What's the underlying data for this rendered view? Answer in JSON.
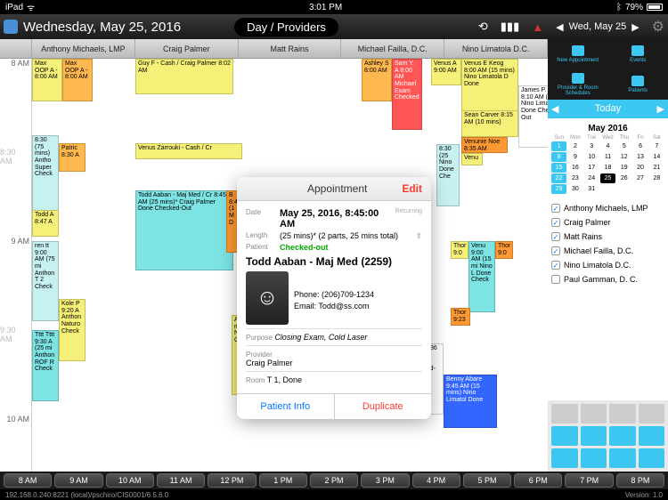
{
  "status": {
    "device": "iPad",
    "wifi": "wifi-icon",
    "time": "3:01 PM",
    "bt": "bt-icon",
    "battery": "79%"
  },
  "header": {
    "date": "Wednesday, May 25, 2016",
    "view": "Day / Providers",
    "nav_label": "Wed, May 25"
  },
  "providers": [
    "Anthony Michaels, LMP",
    "Craig Palmer",
    "Matt Rains",
    "Michael Failla, D.C.",
    "Nino Limatola D.C."
  ],
  "time_labels": [
    "8 AM",
    "8:30 AM",
    "9 AM",
    "9:30 AM",
    "10 AM"
  ],
  "appts": {
    "max1": "Max OOP A - 8:00 AM",
    "max2": "Max OOP A - 8:00 AM",
    "guy": "Guy F - Cash / Craig Palmer\n8:02 AM",
    "ashley": "Ashley S\n8:00 AM",
    "sam": "Sam Y. A\n8:00 AM\nMichael\nExam\nChecked",
    "venusA": "Venus A\n9:00 AM",
    "venusE": "Venus E Keog\n8:00 AM\n(15 mins)\nNino Limatola D\nDone",
    "sean": "Sean Carver\n8:15 AM\n(10 mins)",
    "venunie": "Venunie Noe\n8:35 AM",
    "venu": "Venu",
    "james": "James P. Aba\n8:10 AM\n(0 mins)\nNino Limatola\nDone\nChecked-Out",
    "patric": "Patric\n8:30 A",
    "cyan830": "8:30\n(75 mins)\nAntho\nSuper\nCheck",
    "venusZ": "Venus Zarrouki - Cash / Cr",
    "todd847": "Todd A\n8:47 A",
    "toddA": "Todd Aaban - Maj Med / Cr\n8:45 AM\n(25 mins)*\nCraig Palmer\nDone\nChecked-Out",
    "orange845": "B\n8:4\n(1\nM\nD",
    "ren": "ren tt\n9:00 AM\n(75 mi\nAnthon\nT 2\nCheck",
    "kole": "Kole P\n9:20 A\nAnthon\nNaturo\nCheck",
    "tttt": "Tttt Tttt\n9:30 A\n(25 mi\nAnthon\nROF R\nCheck",
    "a925": "A\n9:25 AM\n(25 mins)\nMatt Rains\nNaturopathy\nChecked-In",
    "g9": "9:\n(2\nM\nT\nC",
    "thor1": "Thor\n9:0",
    "thor2": "Thor\n9:23",
    "venu9": "Venu\n9:00 AM\n(15 mi\nNino L\nDone\nCheck",
    "b930": "8:30\n(25\nNino\nDone\nChe",
    "patrick": "Patrick Star\n9:36 AM\n(15 mins)\nMichael Failla\nExam\nChecked-Out",
    "benny": "Benny Abare\n9:45 AM\n(15 mins)\nNino Limatol\nDone"
  },
  "popup": {
    "title": "Appointment",
    "edit": "Edit",
    "date_lbl": "Date",
    "date": "May 25, 2016, 8:45:00 AM",
    "recurring": "Recurring",
    "length_lbl": "Length",
    "length": "(25 mins)* (2 parts, 25 mins total)",
    "patient_lbl": "Patient",
    "status": "Checked-out",
    "patient_name": "Todd Aaban - Maj Med (2259)",
    "phone": "Phone: (206)709-1234",
    "email": "Email: Todd@ss.com",
    "purpose_lbl": "Purpose",
    "purpose": "Closing Exam, Cold Laser",
    "provider_lbl": "Provider",
    "provider": "Craig Palmer",
    "room_lbl": "Room",
    "room": "T 1, Done",
    "patient_info": "Patient Info",
    "duplicate": "Duplicate"
  },
  "rp": {
    "new_appt": "New Appointment",
    "events": "Events",
    "pr_sched": "Provider & Room\nSchedules",
    "patients": "Patients",
    "today": "Today",
    "month": "May 2016",
    "dow": [
      "Sun",
      "Mon",
      "Tue",
      "Wed",
      "Thu",
      "Fri",
      "Sat"
    ],
    "days": [
      "1",
      "2",
      "3",
      "4",
      "5",
      "6",
      "7",
      "8",
      "9",
      "10",
      "11",
      "12",
      "13",
      "14",
      "15",
      "16",
      "17",
      "18",
      "19",
      "20",
      "21",
      "22",
      "23",
      "24",
      "25",
      "26",
      "27",
      "28",
      "29",
      "30",
      "31"
    ],
    "prov_list": [
      {
        "name": "Anthony Michaels, LMP",
        "checked": true
      },
      {
        "name": "Craig Palmer",
        "checked": true
      },
      {
        "name": "Matt Rains",
        "checked": true
      },
      {
        "name": "Michael Failla, D.C.",
        "checked": true
      },
      {
        "name": "Nino Limatola D.C.",
        "checked": true
      },
      {
        "name": "Paul Gamman, D. C.",
        "checked": false
      }
    ]
  },
  "hours": [
    "8 AM",
    "9 AM",
    "10 AM",
    "11 AM",
    "12 PM",
    "1 PM",
    "2 PM",
    "3 PM",
    "4 PM",
    "5 PM",
    "6 PM",
    "7 PM",
    "8 PM"
  ],
  "footer": {
    "left": "192.168.0.240:8221 (local)/pschiro/CIS0001/6.5.6.0",
    "right": "Version: 1.0"
  }
}
